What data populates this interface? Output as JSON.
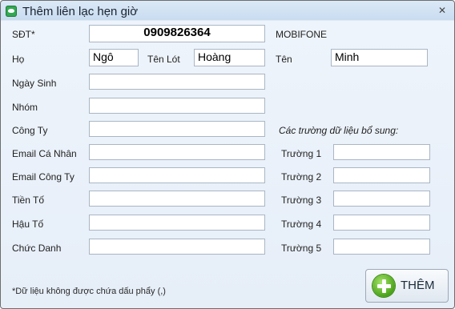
{
  "window": {
    "title": "Thêm liên lạc hẹn giờ",
    "close_glyph": "✕"
  },
  "phone": {
    "label": "SĐT*",
    "value": "0909826364",
    "carrier": "MOBIFONE"
  },
  "name": {
    "last_label": "Họ",
    "last_value": "Ngô",
    "middle_label": "Tên Lót",
    "middle_value": "Hoàng",
    "first_label": "Tên",
    "first_value": "Minh"
  },
  "fields": [
    {
      "label": "Ngày Sinh",
      "value": ""
    },
    {
      "label": "Nhóm",
      "value": ""
    },
    {
      "label": "Công Ty",
      "value": ""
    },
    {
      "label": "Email Cá Nhân",
      "value": ""
    },
    {
      "label": "Email Công Ty",
      "value": ""
    },
    {
      "label": "Tiền Tố",
      "value": ""
    },
    {
      "label": "Hậu Tố",
      "value": ""
    },
    {
      "label": "Chức Danh",
      "value": ""
    }
  ],
  "extra": {
    "heading": "Các trường dữ liệu bổ sung:",
    "fields": [
      {
        "label": "Trường 1",
        "value": ""
      },
      {
        "label": "Trường 2",
        "value": ""
      },
      {
        "label": "Trường 3",
        "value": ""
      },
      {
        "label": "Trường 4",
        "value": ""
      },
      {
        "label": "Trường 5",
        "value": ""
      }
    ]
  },
  "note": "*Dữ liệu không được chứa dấu phẩy (,)",
  "add_button": {
    "label": "THÊM",
    "icon": "plus-icon"
  }
}
